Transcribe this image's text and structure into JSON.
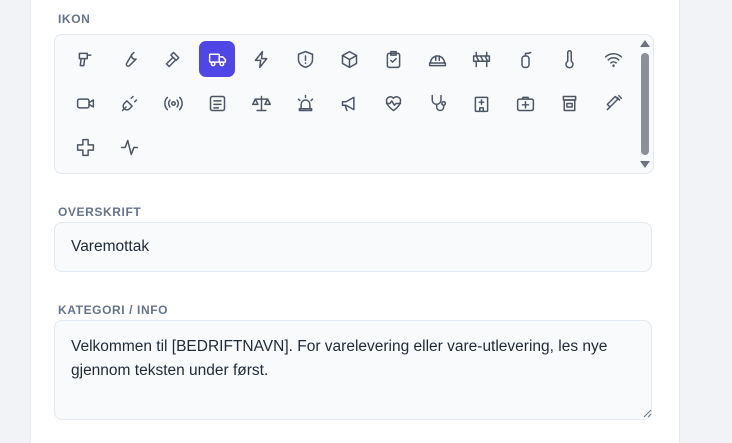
{
  "icon_section": {
    "label": "IKON",
    "selected_icon": "truck-icon",
    "icons": [
      "drill-icon",
      "wrench-icon",
      "hammer-icon",
      "truck-icon",
      "lightning-icon",
      "shield-alert-icon",
      "box-icon",
      "clipboard-check-icon",
      "hard-hat-icon",
      "barrier-icon",
      "fire-extinguisher-icon",
      "thermometer-icon",
      "wifi-icon",
      "camera-icon",
      "plug-icon",
      "radio-icon",
      "document-icon",
      "scale-icon",
      "siren-icon",
      "megaphone-icon",
      "heart-pulse-icon",
      "stethoscope-icon",
      "hospital-icon",
      "first-aid-kit-icon",
      "pill-bottle-icon",
      "syringe-icon",
      "cross-icon",
      "activity-icon"
    ]
  },
  "heading_section": {
    "label": "OVERSKRIFT",
    "value": "Varemottak"
  },
  "info_section": {
    "label": "KATEGORI / INFO",
    "value": "Velkommen til [BEDRIFTNAVN]. For varelevering eller vare-utlevering, les nye gjennom teksten under først."
  },
  "colors": {
    "accent": "#4f46e5",
    "label": "#64748b",
    "field_bg": "#f8fafc",
    "field_border": "#e2e8f0"
  }
}
